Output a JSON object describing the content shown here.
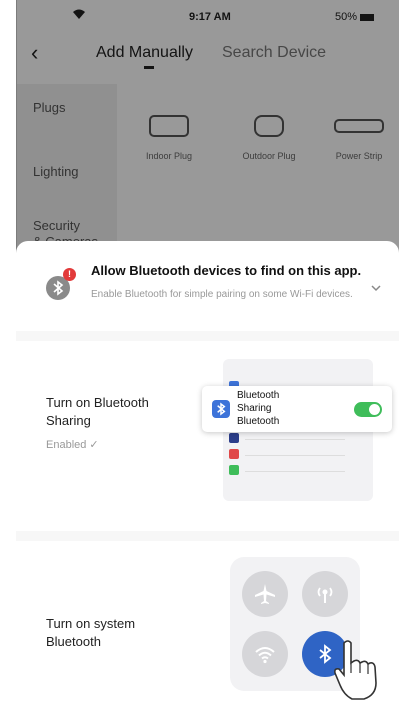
{
  "status_bar": {
    "time": "9:17 AM",
    "battery": "50%"
  },
  "nav": {
    "back_icon": "chevron-left-icon",
    "tab_active": "Add Manually",
    "tab_inactive": "Search Device"
  },
  "sidebar": {
    "items": [
      "Plugs",
      "Lighting",
      "Security\n& Cameras"
    ]
  },
  "devices": [
    {
      "label": "Indoor Plug",
      "icon": "indoor-plug-icon"
    },
    {
      "label": "Outdoor Plug",
      "icon": "outdoor-plug-icon"
    },
    {
      "label": "Power Strip",
      "icon": "power-strip-icon"
    }
  ],
  "banner": {
    "title": "Allow Bluetooth devices to find on this app.",
    "subtitle": "Enable Bluetooth for simple pairing on some Wi-Fi devices.",
    "error_badge": "!",
    "icon": "bluetooth-icon",
    "expand_icon": "chevron-down-icon"
  },
  "step_sharing": {
    "title": "Turn on Bluetooth\nSharing",
    "status": "Enabled ✓",
    "popup_label": "Bluetooth\nSharing\nBluetooth"
  },
  "step_system": {
    "title": "Turn on system\nBluetooth"
  },
  "colors": {
    "accent_blue": "#2f64c5",
    "toggle_green": "#3fbd5a",
    "alert_red": "#e23a3a"
  }
}
